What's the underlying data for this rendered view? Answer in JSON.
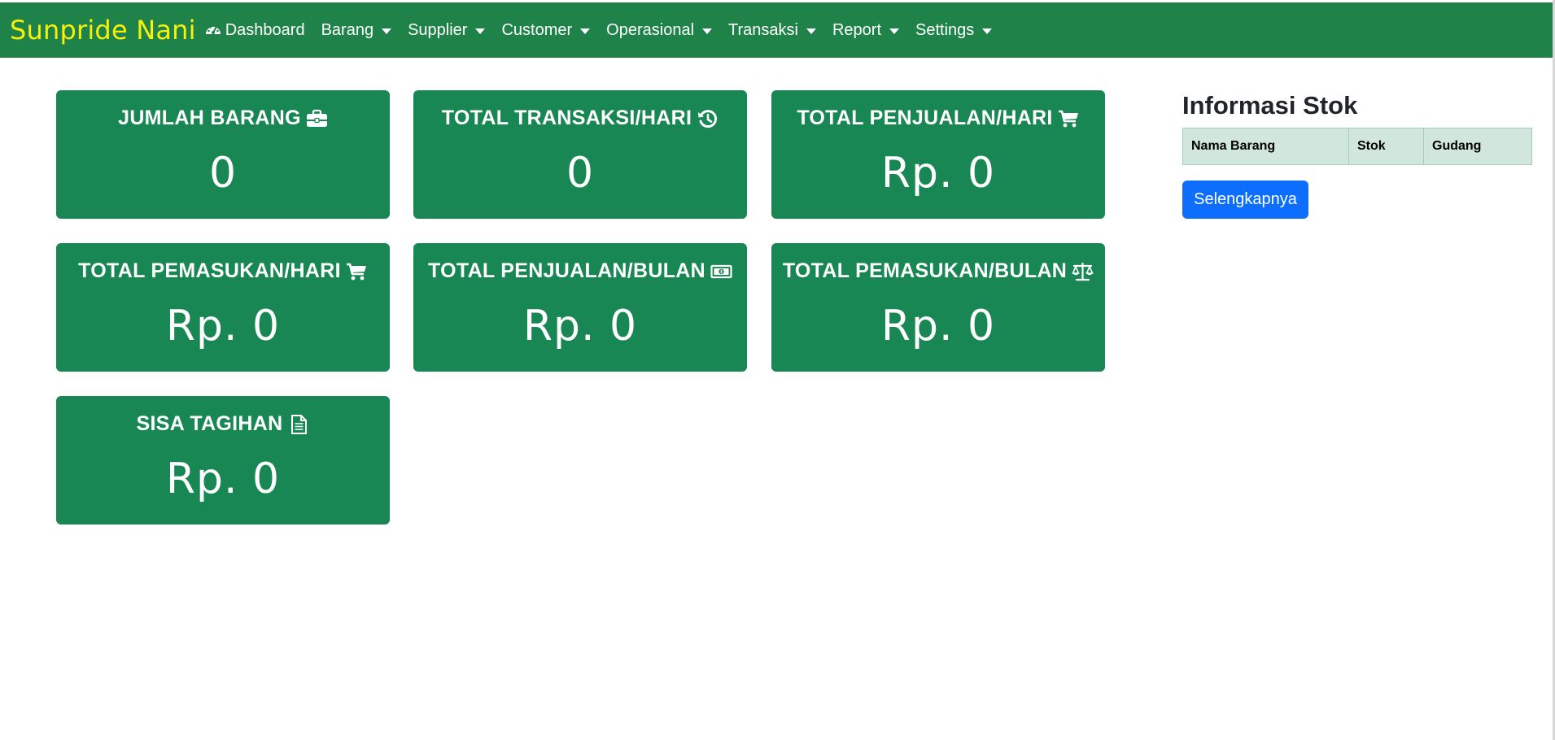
{
  "navbar": {
    "brand": "Sunpride Nani",
    "items": [
      {
        "label": "Dashboard",
        "icon": "gauge-icon",
        "dropdown": false
      },
      {
        "label": "Barang",
        "dropdown": true
      },
      {
        "label": "Supplier",
        "dropdown": true
      },
      {
        "label": "Customer",
        "dropdown": true
      },
      {
        "label": "Operasional",
        "dropdown": true
      },
      {
        "label": "Transaksi",
        "dropdown": true
      },
      {
        "label": "Report",
        "dropdown": true
      },
      {
        "label": "Settings",
        "dropdown": true
      }
    ]
  },
  "cards": [
    {
      "title": "JUMLAH BARANG",
      "icon": "briefcase-icon",
      "value": "0"
    },
    {
      "title": "TOTAL TRANSAKSI/HARI",
      "icon": "history-icon",
      "value": "0"
    },
    {
      "title": "TOTAL PENJUALAN/HARI",
      "icon": "cart-icon",
      "value": "Rp. 0"
    },
    {
      "title": "TOTAL PEMASUKAN/HARI",
      "icon": "cart-icon",
      "value": "Rp. 0"
    },
    {
      "title": "TOTAL PENJUALAN/BULAN",
      "icon": "money-icon",
      "value": "Rp. 0"
    },
    {
      "title": "TOTAL PEMASUKAN/BULAN",
      "icon": "balance-scale-icon",
      "value": "Rp. 0"
    },
    {
      "title": "SISA TAGIHAN",
      "icon": "document-icon",
      "value": "Rp. 0"
    }
  ],
  "stock": {
    "title": "Informasi Stok",
    "columns": [
      "Nama Barang",
      "Stok",
      "Gudang"
    ],
    "button_label": "Selengkapnya"
  },
  "colors": {
    "navbar": "#1e8249",
    "brand": "#f5f10b",
    "card": "#198754",
    "table_header": "#d1e7dd",
    "button": "#0d6efd"
  }
}
